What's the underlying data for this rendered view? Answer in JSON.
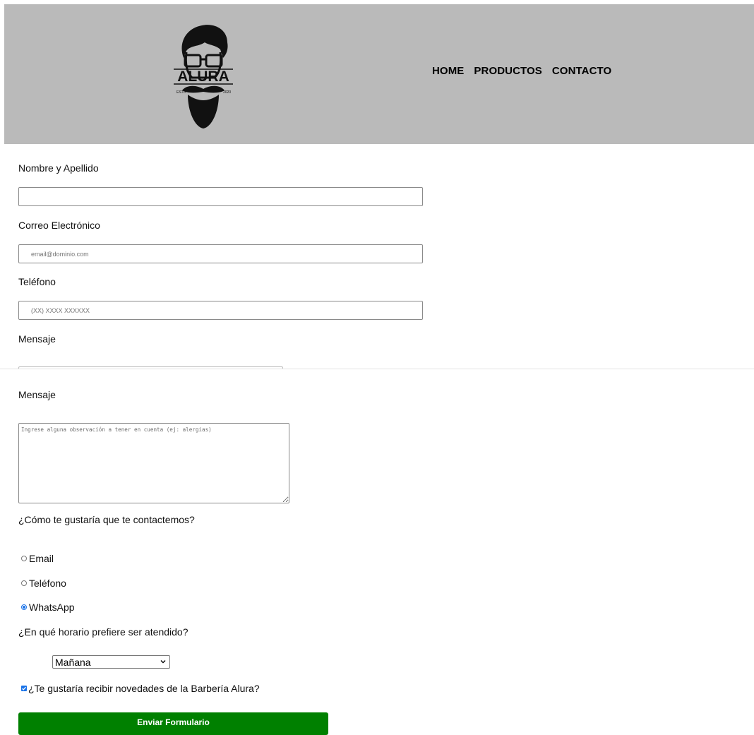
{
  "header": {
    "logo": {
      "text": "ALURA",
      "left_year": "ESTD",
      "right_year": "2020"
    },
    "nav": [
      "HOME",
      "PRODUCTOS",
      "CONTACTO"
    ]
  },
  "form": {
    "name_label": "Nombre y Apellido",
    "email_label": "Correo Electrónico",
    "email_placeholder": "email@dominio.com",
    "phone_label": "Teléfono",
    "phone_placeholder": "(XX) XXXX XXXXXX",
    "message_label_cut": "Mensaje",
    "message_label": "Mensaje",
    "message_placeholder": "Ingrese alguna observación a tener en cuenta (ej: alergias)",
    "contact_question": "¿Cómo te gustaría que te contactemos?",
    "contact_options": [
      {
        "label": "Email",
        "checked": false
      },
      {
        "label": "Teléfono",
        "checked": false
      },
      {
        "label": "WhatsApp",
        "checked": true
      }
    ],
    "schedule_question": "¿En qué horario prefiere ser atendido?",
    "schedule_selected": "Mañana",
    "newsletter_label": "¿Te gustaría recibir novedades de la Barbería Alura?",
    "newsletter_checked": true,
    "submit_label": "Enviar Formulario"
  },
  "colors": {
    "header_bg": "#bababa",
    "submit_bg": "#008000",
    "accent": "#1a73e8"
  }
}
